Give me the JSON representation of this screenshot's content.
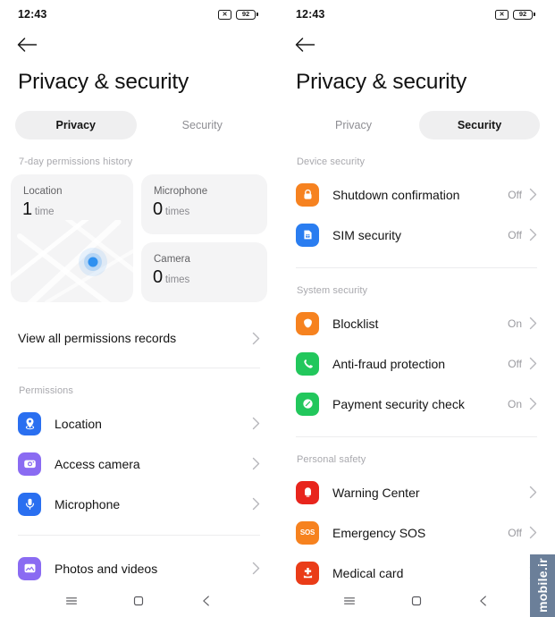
{
  "status_bar": {
    "time": "12:43",
    "battery_percent": "92",
    "sim_icon": "no-sim-icon"
  },
  "title": "Privacy & security",
  "tabs": {
    "privacy": "Privacy",
    "security": "Security"
  },
  "privacy_screen": {
    "active_tab": "Privacy",
    "history_label": "7-day permissions history",
    "cards": [
      {
        "title": "Location",
        "count": "1",
        "unit": "time"
      },
      {
        "title": "Microphone",
        "count": "0",
        "unit": "times"
      },
      {
        "title": "Camera",
        "count": "0",
        "unit": "times"
      }
    ],
    "view_all_label": "View all permissions records",
    "permissions_label": "Permissions",
    "permissions": [
      {
        "label": "Location",
        "icon": "location-pin-icon",
        "color": "#2a6ff0"
      },
      {
        "label": "Access camera",
        "icon": "camera-icon",
        "color": "#8a6bf2"
      },
      {
        "label": "Microphone",
        "icon": "microphone-icon",
        "color": "#2a6ff0"
      },
      {
        "label": "Photos and videos",
        "icon": "photos-icon",
        "color": "#8a6bf2"
      }
    ]
  },
  "security_screen": {
    "active_tab": "Security",
    "sections": [
      {
        "label": "Device security",
        "items": [
          {
            "label": "Shutdown confirmation",
            "value": "Off",
            "icon": "lock-icon",
            "color": "#f68220"
          },
          {
            "label": "SIM security",
            "value": "Off",
            "icon": "sim-card-icon",
            "color": "#2a7df0"
          }
        ]
      },
      {
        "label": "System security",
        "items": [
          {
            "label": "Blocklist",
            "value": "On",
            "icon": "blocklist-icon",
            "color": "#f6821f"
          },
          {
            "label": "Anti-fraud protection",
            "value": "Off",
            "icon": "phone-icon",
            "color": "#22c75c"
          },
          {
            "label": "Payment security check",
            "value": "On",
            "icon": "payment-shield-icon",
            "color": "#22c75c"
          }
        ]
      },
      {
        "label": "Personal safety",
        "items": [
          {
            "label": "Warning Center",
            "value": "",
            "icon": "bell-alert-icon",
            "color": "#e8251d"
          },
          {
            "label": "Emergency SOS",
            "value": "Off",
            "icon": "sos-icon",
            "color": "#f6821f"
          },
          {
            "label": "Medical card",
            "value": "",
            "icon": "medical-cross-icon",
            "color": "#ea3c18"
          }
        ]
      }
    ]
  },
  "navigation_bar": {
    "recents": "recents-icon",
    "home": "home-icon",
    "back": "back-icon"
  },
  "watermark": "mobile.ir"
}
